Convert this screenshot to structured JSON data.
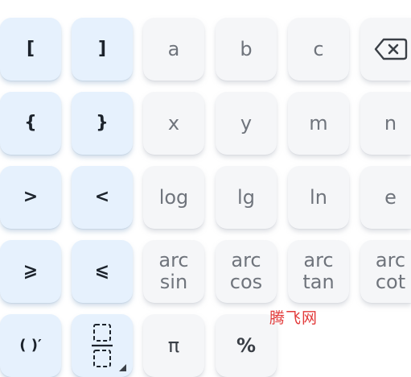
{
  "keys": {
    "open_bracket": "[",
    "close_bracket": "]",
    "a": "a",
    "b": "b",
    "c": "c",
    "open_brace": "{",
    "close_brace": "}",
    "x": "x",
    "y": "y",
    "m": "m",
    "n": "n",
    "greater": ">",
    "less": "<",
    "log": "log",
    "lg": "lg",
    "ln": "ln",
    "e": "e",
    "geq": "⩾",
    "leq": "⩽",
    "arcsin": "arc\nsin",
    "arccos": "arc\ncos",
    "arctan": "arc\ntan",
    "arccot": "arc\ncot",
    "derivative": "( )′",
    "pi": "π",
    "percent": "%"
  },
  "icons": {
    "backspace": "backspace-icon",
    "fraction": "fraction-template-icon"
  },
  "watermark": "腾飞网",
  "colors": {
    "blue_key": "#e6f1fd",
    "gray_key": "#f5f6f8",
    "watermark": "#e23a3a"
  }
}
